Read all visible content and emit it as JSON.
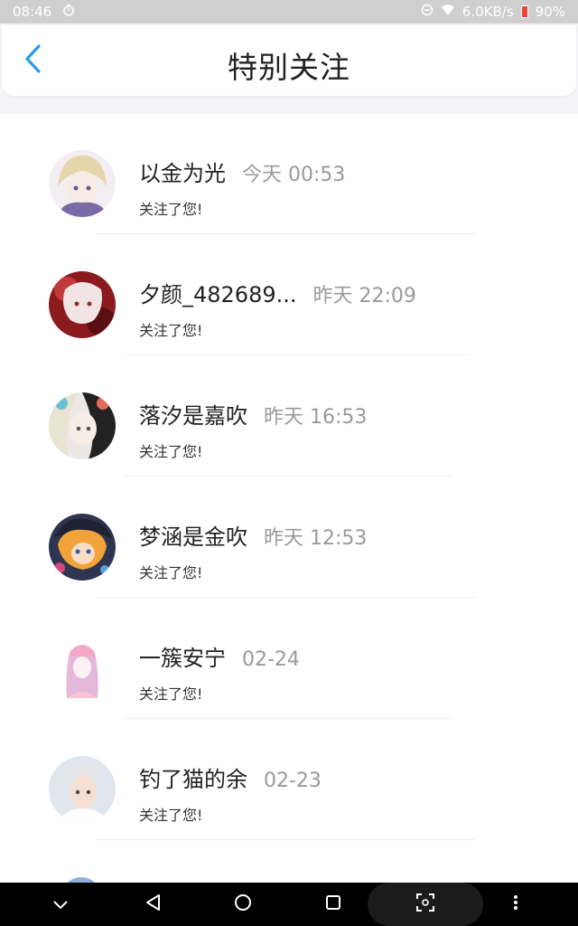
{
  "status_bar": {
    "time": "08:46",
    "network_speed": "6.0KB/s",
    "battery": "90%"
  },
  "header": {
    "title": "特别关注",
    "back_icon": "chevron-left-icon",
    "accent_color": "#2c9be8"
  },
  "items": [
    {
      "name": "以金为光",
      "time": "今天 00:53",
      "desc": "关注了您!"
    },
    {
      "name": "夕颜_482689...",
      "time": "昨天 22:09",
      "desc": "关注了您!"
    },
    {
      "name": "落汐是嘉吹",
      "time": "昨天 16:53",
      "desc": "关注了您!"
    },
    {
      "name": "梦涵是金吹",
      "time": "昨天 12:53",
      "desc": "关注了您!"
    },
    {
      "name": "一簇安宁",
      "time": "02-24",
      "desc": "关注了您!"
    },
    {
      "name": "钓了猫的余",
      "time": "02-23",
      "desc": "关注了您!"
    }
  ],
  "nav_bar": {
    "icons": [
      "chevron-down-icon",
      "back-triangle-icon",
      "home-circle-icon",
      "recents-square-icon",
      "scan-icon",
      "more-vert-icon"
    ]
  }
}
